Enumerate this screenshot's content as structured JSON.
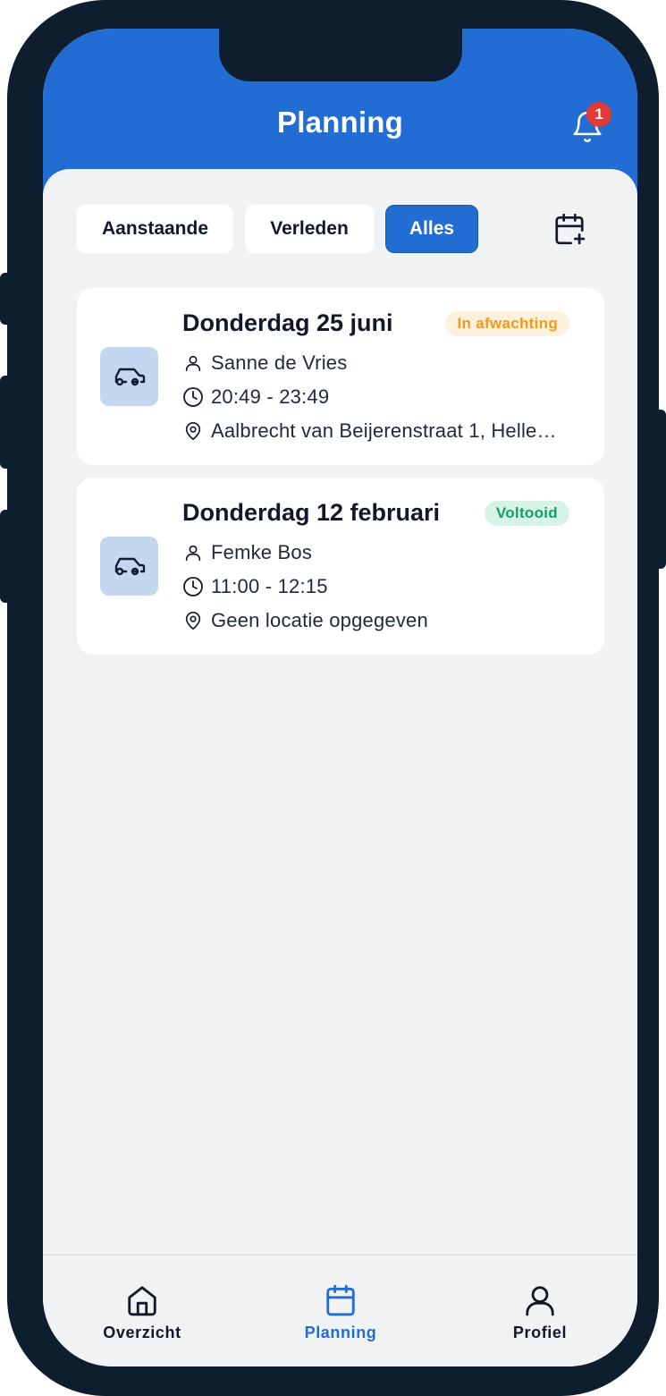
{
  "header": {
    "title": "Planning",
    "notification_count": "1"
  },
  "filters": [
    {
      "label": "Aanstaande",
      "active": false
    },
    {
      "label": "Verleden",
      "active": false
    },
    {
      "label": "Alles",
      "active": true
    }
  ],
  "appointments": [
    {
      "date": "Donderdag 25 juni",
      "status": "In afwachting",
      "person": "Sanne de Vries",
      "time": "20:49 - 23:49",
      "location": "Aalbrecht van Beijerenstraat 1, Helle…"
    },
    {
      "date": "Donderdag 12 februari",
      "status": "Voltooid",
      "person": "Femke Bos",
      "time": "11:00 - 12:15",
      "location": "Geen locatie opgegeven"
    }
  ],
  "tabbar": {
    "items": [
      {
        "label": "Overzicht",
        "icon": "home-icon",
        "active": false
      },
      {
        "label": "Planning",
        "icon": "calendar-icon",
        "active": true
      },
      {
        "label": "Profiel",
        "icon": "user-icon",
        "active": false
      }
    ]
  },
  "colors": {
    "primary": "#216dd3",
    "background": "#f1f2f4",
    "pending_text": "#ef9a1f",
    "pending_bg": "#fdf0dc",
    "done_text": "#14a060",
    "done_bg": "#d7f3e5",
    "badge": "#e53935",
    "frame": "#0f1e2f"
  }
}
